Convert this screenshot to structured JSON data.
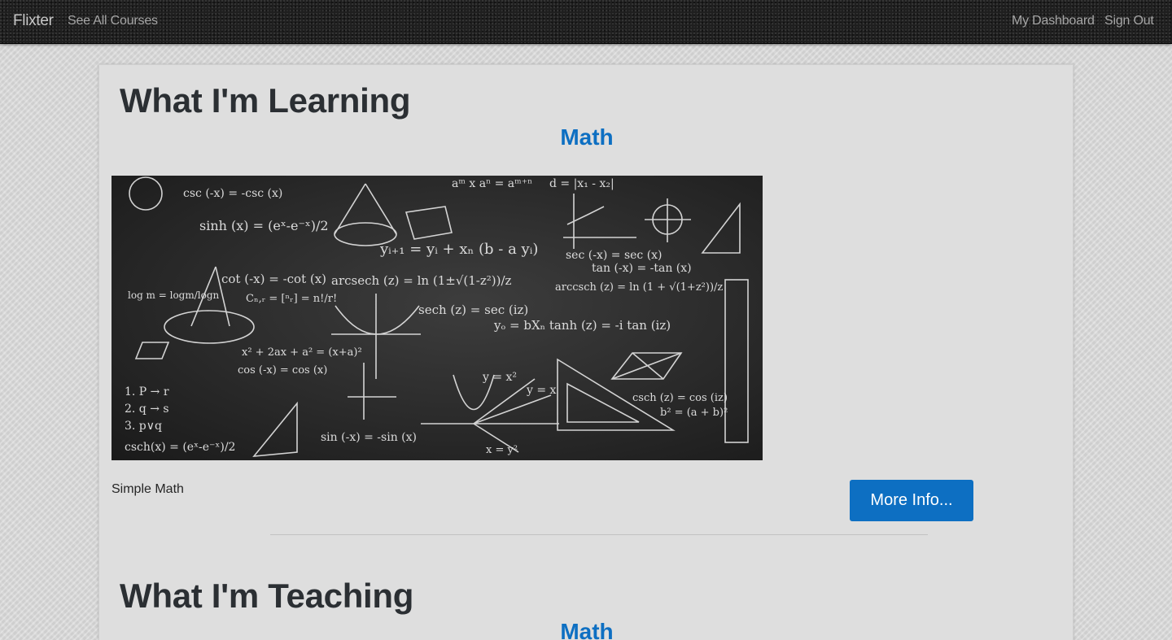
{
  "navbar": {
    "brand": "Flixter",
    "links": {
      "all_courses": "See All Courses",
      "dashboard": "My Dashboard",
      "sign_out": "Sign Out"
    }
  },
  "learning": {
    "heading": "What I'm Learning",
    "course": {
      "title": "Math",
      "description": "Simple Math",
      "button": "More Info...",
      "image": {
        "alt": "chalkboard with math formulas",
        "formulas": [
          "csc (-x) = -csc (x)",
          "sinh (x) = (eˣ-e⁻ˣ)/2",
          "cot (-x) = -cot (x)",
          "arcsech (z) = ln (1±√(1-z²))/z",
          "yᵢ₊₁ = yᵢ + xₙ (b - a yᵢ)",
          "sec (-x) = sec (x)",
          "tan (-x) = -tan (x)",
          "sech (z) = sec (iz)",
          "yₒ = bXₙ tanh (z) = -i tan (iz)",
          "cos (-x) = cos (x)",
          "sin (-x) = -sin (x)",
          "csch (z) = cos (iz)",
          "csch(x) = (eˣ-e⁻ˣ)/2",
          "1. P → r",
          "2. q → s",
          "3. p∨q",
          "y = x²",
          "y = x",
          "x = y²",
          "b² = (a + b)²",
          "aᵐ x aⁿ = aᵐ⁺ⁿ",
          "d = |x₁ - x₂|",
          "arccsch (z) = ln (1 + √(1+z²))/z",
          "Cₙ,ᵣ = [ⁿᵣ] = n!/r!",
          "log m = logm/logn",
          "x² + 2ax + a² = (x+a)²"
        ]
      }
    }
  },
  "teaching": {
    "heading": "What I'm Teaching",
    "course": {
      "title": "Math"
    }
  }
}
